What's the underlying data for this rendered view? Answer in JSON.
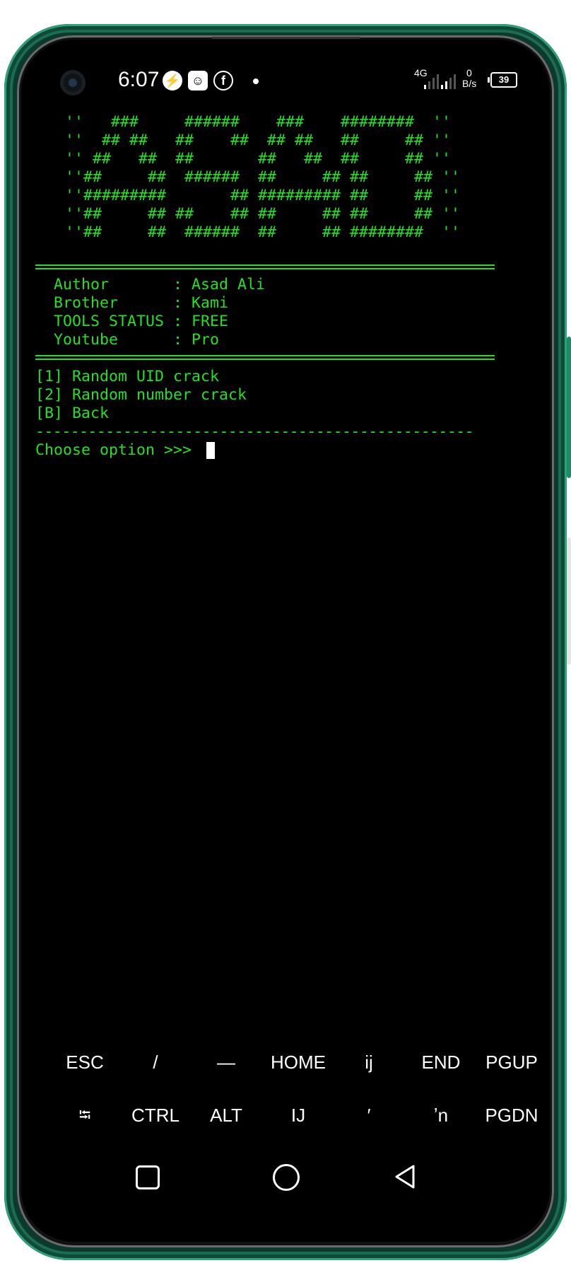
{
  "status_bar": {
    "time": "6:07",
    "notif_icons": [
      "messenger-icon",
      "app-avatar-icon",
      "facebook-icon"
    ],
    "network_type": "4G",
    "net_speed_value": "0",
    "net_speed_unit": "B/s",
    "battery": "39"
  },
  "terminal": {
    "banner": [
      "''   ###     ######    ###    ########  ''",
      "''  ## ##   ##    ##  ## ##   ##     ## ''",
      "'' ##   ##  ##       ##   ##  ##     ## ''",
      "''##     ##  ######  ##     ## ##     ## ''",
      "''#########       ## ######### ##     ## ''",
      "''##     ## ##    ## ##     ## ##     ## ''",
      "''##     ##  ######  ##     ## ########  ''"
    ],
    "info": [
      "  Author       : Asad Ali",
      "  Brother      : Kami",
      "  TOOLS STATUS : FREE",
      "  Youtube      : Pro"
    ],
    "menu": [
      "[1] Random UID crack",
      "[2] Random number crack",
      "[B] Back"
    ],
    "separator": "--------------------------------------------------",
    "prompt": "Choose option >>> "
  },
  "extra_keys": {
    "row1": [
      "ESC",
      "/",
      "—",
      "HOME",
      "ij",
      "END",
      "PGUP"
    ],
    "row2": [
      "⭾",
      "CTRL",
      "ALT",
      "IJ",
      "′",
      "ʼn",
      "PGDN"
    ]
  },
  "nav": [
    "recents-icon",
    "home-icon",
    "back-icon"
  ],
  "colors": {
    "terminal_text": "#22e022",
    "frame": "#0b3a2c"
  }
}
